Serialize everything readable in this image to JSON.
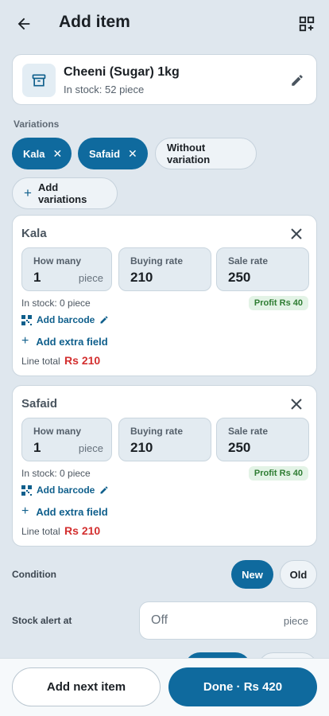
{
  "header": {
    "title": "Add item",
    "back_icon": "arrow-left-icon",
    "scan_icon": "qr-add-icon"
  },
  "product": {
    "name": "Cheeni (Sugar) 1kg",
    "stock": "In stock: 52 piece",
    "icon": "archive-box-icon",
    "edit_icon": "pencil-icon"
  },
  "variations_label": "Variations",
  "chips": {
    "kala": "Kala",
    "safaid": "Safaid",
    "without": "Without variation",
    "add": "Add variations",
    "remove_glyph": "✕",
    "add_glyph": "+"
  },
  "variants": [
    {
      "name": "Kala",
      "qty_label": "How many",
      "qty": "1",
      "unit": "piece",
      "buy_label": "Buying rate",
      "buy": "210",
      "sale_label": "Sale rate",
      "sale": "250",
      "stock": "In stock: 0 piece",
      "profit": "Profit Rs 40",
      "barcode": "Add barcode",
      "extra": "Add extra field",
      "total_label": "Line total",
      "total": "Rs 210"
    },
    {
      "name": "Safaid",
      "qty_label": "How many",
      "qty": "1",
      "unit": "piece",
      "buy_label": "Buying rate",
      "buy": "210",
      "sale_label": "Sale rate",
      "sale": "250",
      "stock": "In stock: 0 piece",
      "profit": "Profit Rs 40",
      "barcode": "Add barcode",
      "extra": "Add extra field",
      "total_label": "Line total",
      "total": "Rs 210"
    }
  ],
  "condition": {
    "label": "Condition",
    "new": "New",
    "old": "Old",
    "selected": "New"
  },
  "stock_alert": {
    "label": "Stock alert at",
    "value": "Off",
    "unit": "piece"
  },
  "footer": {
    "next": "Add next item",
    "done": "Done · Rs 420"
  },
  "colors": {
    "primary": "#0f6a9e",
    "background": "#dfe7ee",
    "profit_text": "#2e7d32",
    "total_text": "#d32f2f"
  }
}
